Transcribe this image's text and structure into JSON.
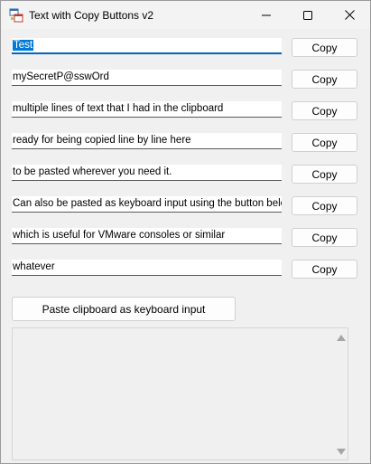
{
  "window": {
    "title": "Text with Copy Buttons v2",
    "icon": "app-window-icon",
    "controls": [
      "minimize-icon",
      "maximize-icon",
      "close-icon"
    ]
  },
  "rows": [
    {
      "text": "Test",
      "button": "Copy"
    },
    {
      "text": "mySecretP@sswOrd",
      "button": "Copy"
    },
    {
      "text": "multiple lines of text that I had in the clipboard",
      "button": "Copy"
    },
    {
      "text": "ready for being copied line by line here",
      "button": "Copy"
    },
    {
      "text": "to be pasted wherever you need it.",
      "button": "Copy"
    },
    {
      "text": "Can also be pasted as keyboard input using the button below",
      "button": "Copy"
    },
    {
      "text": "which is useful for VMware consoles or similar",
      "button": "Copy"
    },
    {
      "text": "whatever",
      "button": "Copy"
    }
  ],
  "paste_button": "Paste clipboard as keyboard input",
  "output_area": {
    "text": ""
  },
  "colors": {
    "selection": "#0078d7",
    "focus_underline": "#0067c0"
  }
}
